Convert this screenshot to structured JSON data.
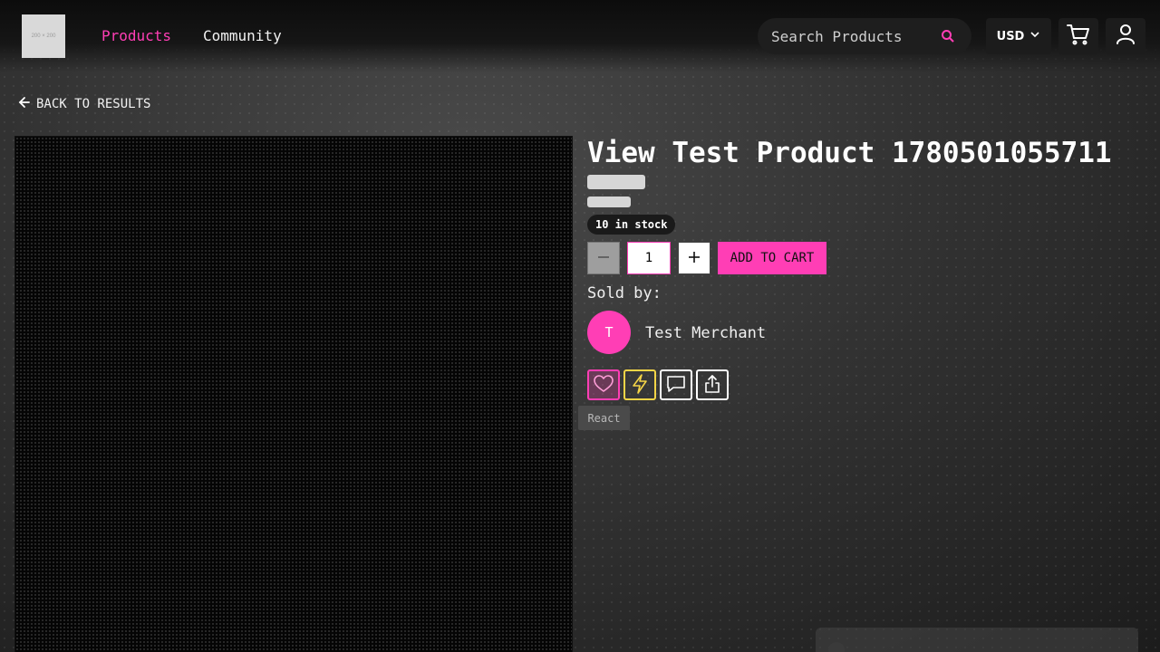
{
  "header": {
    "logo_text": "200 × 200",
    "nav": [
      {
        "label": "Products",
        "active": true
      },
      {
        "label": "Community",
        "active": false
      }
    ],
    "search": {
      "placeholder": "Search Products",
      "value": ""
    },
    "currency": "USD",
    "icons": {
      "search": "search-icon",
      "currency_caret": "chevron-down-icon",
      "cart": "cart-icon",
      "user": "user-icon"
    }
  },
  "back_link": {
    "label": "BACK TO RESULTS",
    "icon": "arrow-left-icon"
  },
  "product": {
    "title": "View Test Product 1780501055711",
    "stock": "10 in stock",
    "quantity": "1",
    "add_to_cart_label": "ADD TO CART",
    "sold_by_label": "Sold by:",
    "merchant": {
      "initial": "T",
      "name": "Test Merchant"
    }
  },
  "actions": [
    {
      "name": "heart-icon",
      "label": "React"
    },
    {
      "name": "zap-icon"
    },
    {
      "name": "comment-icon"
    },
    {
      "name": "share-icon"
    }
  ],
  "tooltip": "React",
  "colors": {
    "accent": "#ff3eb5",
    "zap": "#f5d547",
    "header_bg": "#0c0c0c"
  }
}
